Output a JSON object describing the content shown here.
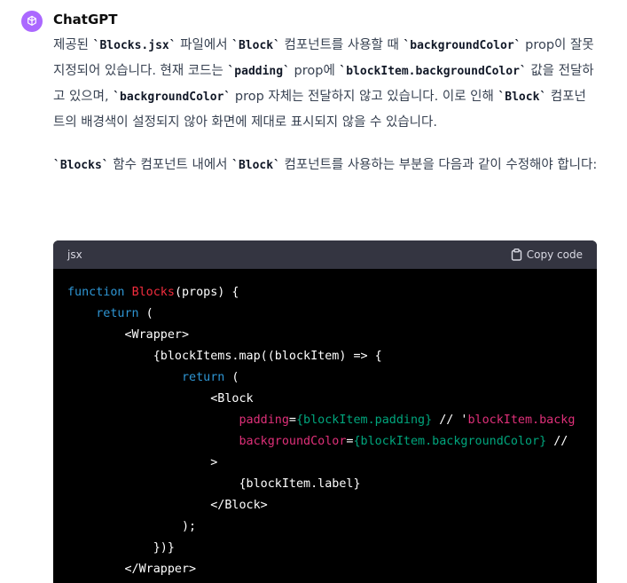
{
  "assistant": {
    "name": "ChatGPT",
    "avatar_icon": "openai-logo-icon",
    "avatar_color": "#ab68ff"
  },
  "message": {
    "p1": {
      "t1": "제공된 ",
      "c1": "`Blocks.jsx`",
      "t2": " 파일에서 ",
      "c2": "`Block`",
      "t3": " 컴포넌트를 사용할 때 ",
      "c3": "`backgroundColor`",
      "t4": " prop이 잘못 지정되어 있습니다. 현재 코드는 ",
      "c4": "`padding`",
      "t5": " prop에 ",
      "c5": "`blockItem.backgroundColor`",
      "t6": " 값을 전달하고 있으며, ",
      "c6": "`backgroundColor`",
      "t7": " prop 자체는 전달하지 않고 있습니다. 이로 인해 ",
      "c7": "`Block`",
      "t8": " 컴포넌트의 배경색이 설정되지 않아 화면에 제대로 표시되지 않을 수 있습니다."
    },
    "p2": {
      "c1": "`Blocks`",
      "t1": " 함수 컴포넌트 내에서 ",
      "c2": "`Block`",
      "t2": " 컴포넌트를 사용하는 부분을 다음과 같이 수정해야 합니다:"
    }
  },
  "code_block": {
    "language": "jsx",
    "copy_label": "Copy code",
    "copy_icon": "clipboard-icon",
    "lines": [
      {
        "indent": "",
        "parts": [
          {
            "k": "kw",
            "t": "function "
          },
          {
            "k": "fn",
            "t": "Blocks"
          },
          {
            "k": "p",
            "t": "(props) {"
          }
        ]
      },
      {
        "indent": "    ",
        "parts": [
          {
            "k": "kw",
            "t": "return"
          },
          {
            "k": "p",
            "t": " ("
          }
        ]
      },
      {
        "indent": "        ",
        "parts": [
          {
            "k": "p",
            "t": "<Wrapper>"
          }
        ]
      },
      {
        "indent": "            ",
        "parts": [
          {
            "k": "p",
            "t": "{blockItems.map((blockItem) => {"
          }
        ]
      },
      {
        "indent": "                ",
        "parts": [
          {
            "k": "kw",
            "t": "return"
          },
          {
            "k": "p",
            "t": " ("
          }
        ]
      },
      {
        "indent": "                    ",
        "parts": [
          {
            "k": "p",
            "t": "<Block"
          }
        ]
      },
      {
        "indent": "                        ",
        "parts": [
          {
            "k": "attr",
            "t": "padding"
          },
          {
            "k": "p",
            "t": "="
          },
          {
            "k": "val",
            "t": "{blockItem.padding}"
          },
          {
            "k": "p",
            "t": " // '"
          },
          {
            "k": "str",
            "t": "blockItem.backg"
          }
        ]
      },
      {
        "indent": "                        ",
        "parts": [
          {
            "k": "attr",
            "t": "backgroundColor"
          },
          {
            "k": "p",
            "t": "="
          },
          {
            "k": "val",
            "t": "{blockItem.backgroundColor}"
          },
          {
            "k": "p",
            "t": " //"
          }
        ]
      },
      {
        "indent": "                    ",
        "parts": [
          {
            "k": "p",
            "t": ">"
          }
        ]
      },
      {
        "indent": "                        ",
        "parts": [
          {
            "k": "p",
            "t": "{blockItem.label}"
          }
        ]
      },
      {
        "indent": "                    ",
        "parts": [
          {
            "k": "p",
            "t": "</Block>"
          }
        ]
      },
      {
        "indent": "                ",
        "parts": [
          {
            "k": "p",
            "t": ");"
          }
        ]
      },
      {
        "indent": "            ",
        "parts": [
          {
            "k": "p",
            "t": "})}"
          }
        ]
      },
      {
        "indent": "        ",
        "parts": [
          {
            "k": "p",
            "t": "</Wrapper>"
          }
        ]
      }
    ]
  }
}
